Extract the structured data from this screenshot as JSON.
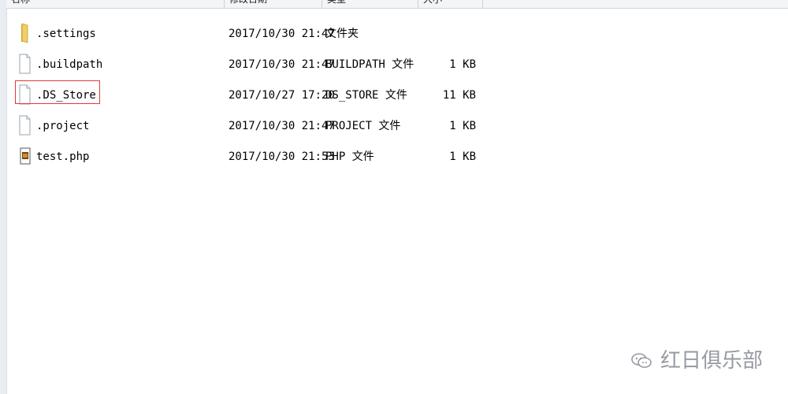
{
  "header": {
    "columns": [
      {
        "label": "名称"
      },
      {
        "label": "修改日期"
      },
      {
        "label": "类型"
      },
      {
        "label": "大小"
      }
    ]
  },
  "files": [
    {
      "name": ".settings",
      "date": "2017/10/30 21:47",
      "type": "文件夹",
      "size": "",
      "icon": "folder-icon"
    },
    {
      "name": ".buildpath",
      "date": "2017/10/30 21:47",
      "type": "BUILDPATH 文件",
      "size": "1 KB",
      "icon": "file-icon"
    },
    {
      "name": ".DS_Store",
      "date": "2017/10/27 17:20",
      "type": "DS_STORE 文件",
      "size": "11 KB",
      "icon": "file-icon",
      "highlighted": true
    },
    {
      "name": ".project",
      "date": "2017/10/30 21:47",
      "type": "PROJECT 文件",
      "size": "1 KB",
      "icon": "file-icon"
    },
    {
      "name": "test.php",
      "date": "2017/10/30 21:53",
      "type": "PHP 文件",
      "size": "1 KB",
      "icon": "php-file-icon"
    }
  ],
  "watermark": {
    "text": "红日俱乐部",
    "icon": "wechat-icon"
  },
  "colors": {
    "highlight_border": "#e03a3a",
    "folder": "#e8c15a",
    "watermark_text": "#8c9097"
  }
}
